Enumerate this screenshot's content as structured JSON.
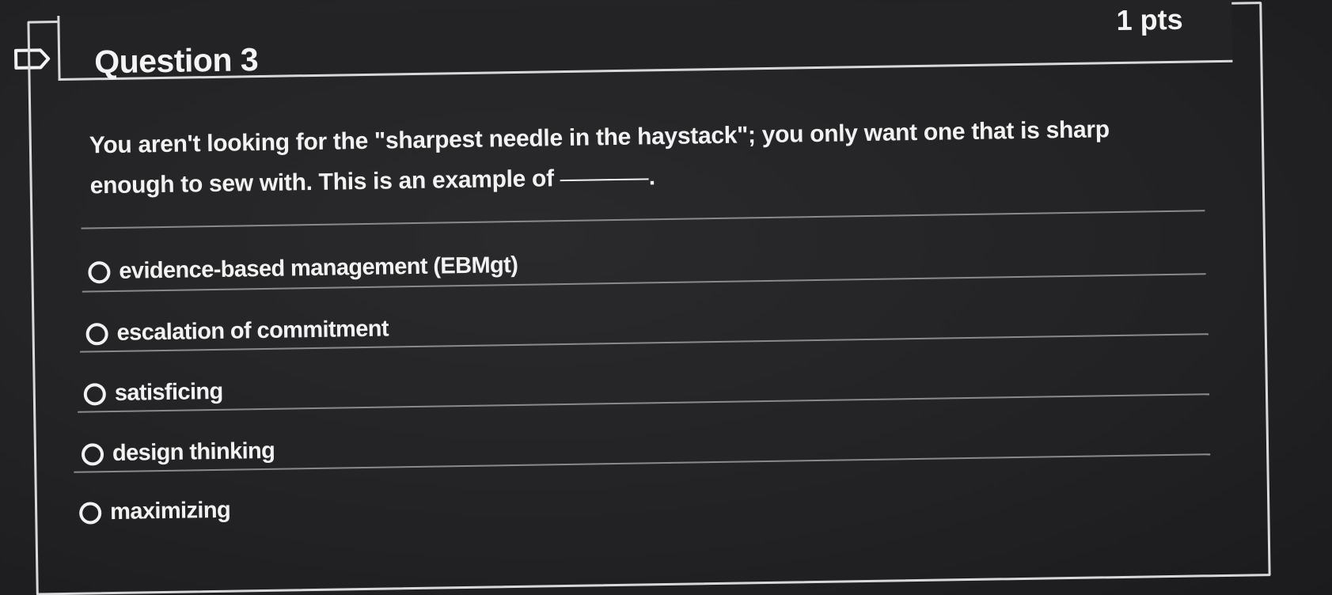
{
  "question": {
    "title": "Question 3",
    "points": "1 pts",
    "prompt": "You aren't looking for the \"sharpest needle in the haystack\"; you only want one that is sharp enough to sew with. This is an example of",
    "prompt_end": "."
  },
  "answers": [
    {
      "label": "evidence-based management (EBMgt)",
      "selected": false
    },
    {
      "label": "escalation of commitment",
      "selected": false
    },
    {
      "label": "satisficing",
      "selected": false
    },
    {
      "label": "design thinking",
      "selected": false
    },
    {
      "label": "maximizing",
      "selected": false
    }
  ],
  "icons": {
    "flag": "flag-icon",
    "radio": "radio-unchecked-icon"
  },
  "colors": {
    "background": "#222224",
    "text": "#f2f2f2",
    "border": "#d9d9d9"
  }
}
